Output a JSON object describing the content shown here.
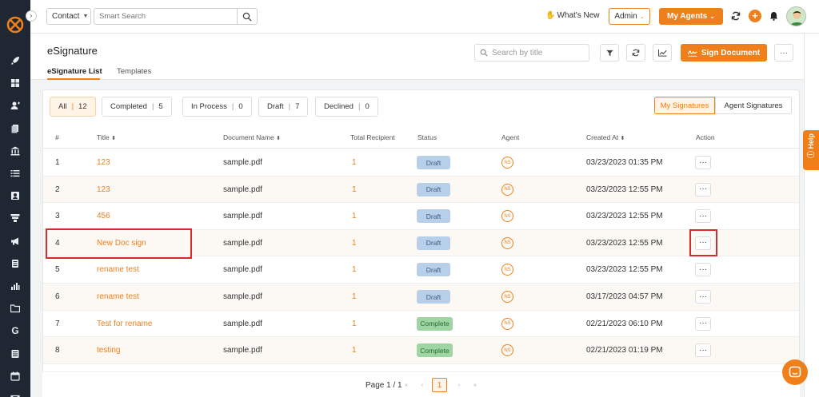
{
  "topbar": {
    "contact_select": "Contact",
    "search_placeholder": "Smart Search",
    "whats_new": "What's New",
    "admin_select": "Admin",
    "my_agents": "My Agents",
    "plus": "+"
  },
  "header": {
    "title": "eSignature",
    "tabs": [
      {
        "label": "eSignature List",
        "active": true
      },
      {
        "label": "Templates",
        "active": false
      }
    ],
    "search_placeholder": "Search by title",
    "sign_document": "Sign Document",
    "more": "···"
  },
  "filters": [
    {
      "label": "All",
      "count": "12",
      "active": true
    },
    {
      "label": "Completed",
      "count": "5",
      "active": false
    },
    {
      "label": "In Process",
      "count": "0",
      "active": false
    },
    {
      "label": "Draft",
      "count": "7",
      "active": false
    },
    {
      "label": "Declined",
      "count": "0",
      "active": false
    }
  ],
  "signature_toggle": {
    "my_signatures": "My Signatures",
    "agent_signatures": "Agent Signatures",
    "active": "my_signatures"
  },
  "table": {
    "columns": {
      "num": "#",
      "title": "Title",
      "document_name": "Document Name",
      "total_recipient": "Total Recipient",
      "status": "Status",
      "agent": "Agent",
      "created_at": "Created At",
      "action": "Action"
    },
    "rows": [
      {
        "num": "1",
        "title": "123",
        "document": "sample.pdf",
        "recipients": "1",
        "status": "Draft",
        "agent": "NS",
        "created": "03/23/2023 01:35 PM",
        "action": "···"
      },
      {
        "num": "2",
        "title": "123",
        "document": "sample.pdf",
        "recipients": "1",
        "status": "Draft",
        "agent": "NS",
        "created": "03/23/2023 12:55 PM",
        "action": "···"
      },
      {
        "num": "3",
        "title": "456",
        "document": "sample.pdf",
        "recipients": "1",
        "status": "Draft",
        "agent": "NS",
        "created": "03/23/2023 12:55 PM",
        "action": "···"
      },
      {
        "num": "4",
        "title": "New Doc sign",
        "document": "sample.pdf",
        "recipients": "1",
        "status": "Draft",
        "agent": "NS",
        "created": "03/23/2023 12:55 PM",
        "action": "···"
      },
      {
        "num": "5",
        "title": "rename test",
        "document": "sample.pdf",
        "recipients": "1",
        "status": "Draft",
        "agent": "NS",
        "created": "03/23/2023 12:55 PM",
        "action": "···"
      },
      {
        "num": "6",
        "title": "rename test",
        "document": "sample.pdf",
        "recipients": "1",
        "status": "Draft",
        "agent": "NS",
        "created": "03/17/2023 04:57 PM",
        "action": "···"
      },
      {
        "num": "7",
        "title": "Test for rename",
        "document": "sample.pdf",
        "recipients": "1",
        "status": "Complete",
        "agent": "NS",
        "created": "02/21/2023 06:10 PM",
        "action": "···"
      },
      {
        "num": "8",
        "title": "testing",
        "document": "sample.pdf",
        "recipients": "1",
        "status": "Complete",
        "agent": "NS",
        "created": "02/21/2023 01:19 PM",
        "action": "···"
      }
    ]
  },
  "pagination": {
    "label": "Page 1 / 1",
    "first": "«",
    "prev": "‹",
    "current": "1",
    "next": "›",
    "last": "»"
  },
  "help": {
    "label": "Help"
  },
  "colors": {
    "accent": "#ef7f1a",
    "sidebar": "#1f2733",
    "draft": "#b8cfea",
    "complete": "#9ed5a2",
    "highlight": "#d62b2b"
  }
}
